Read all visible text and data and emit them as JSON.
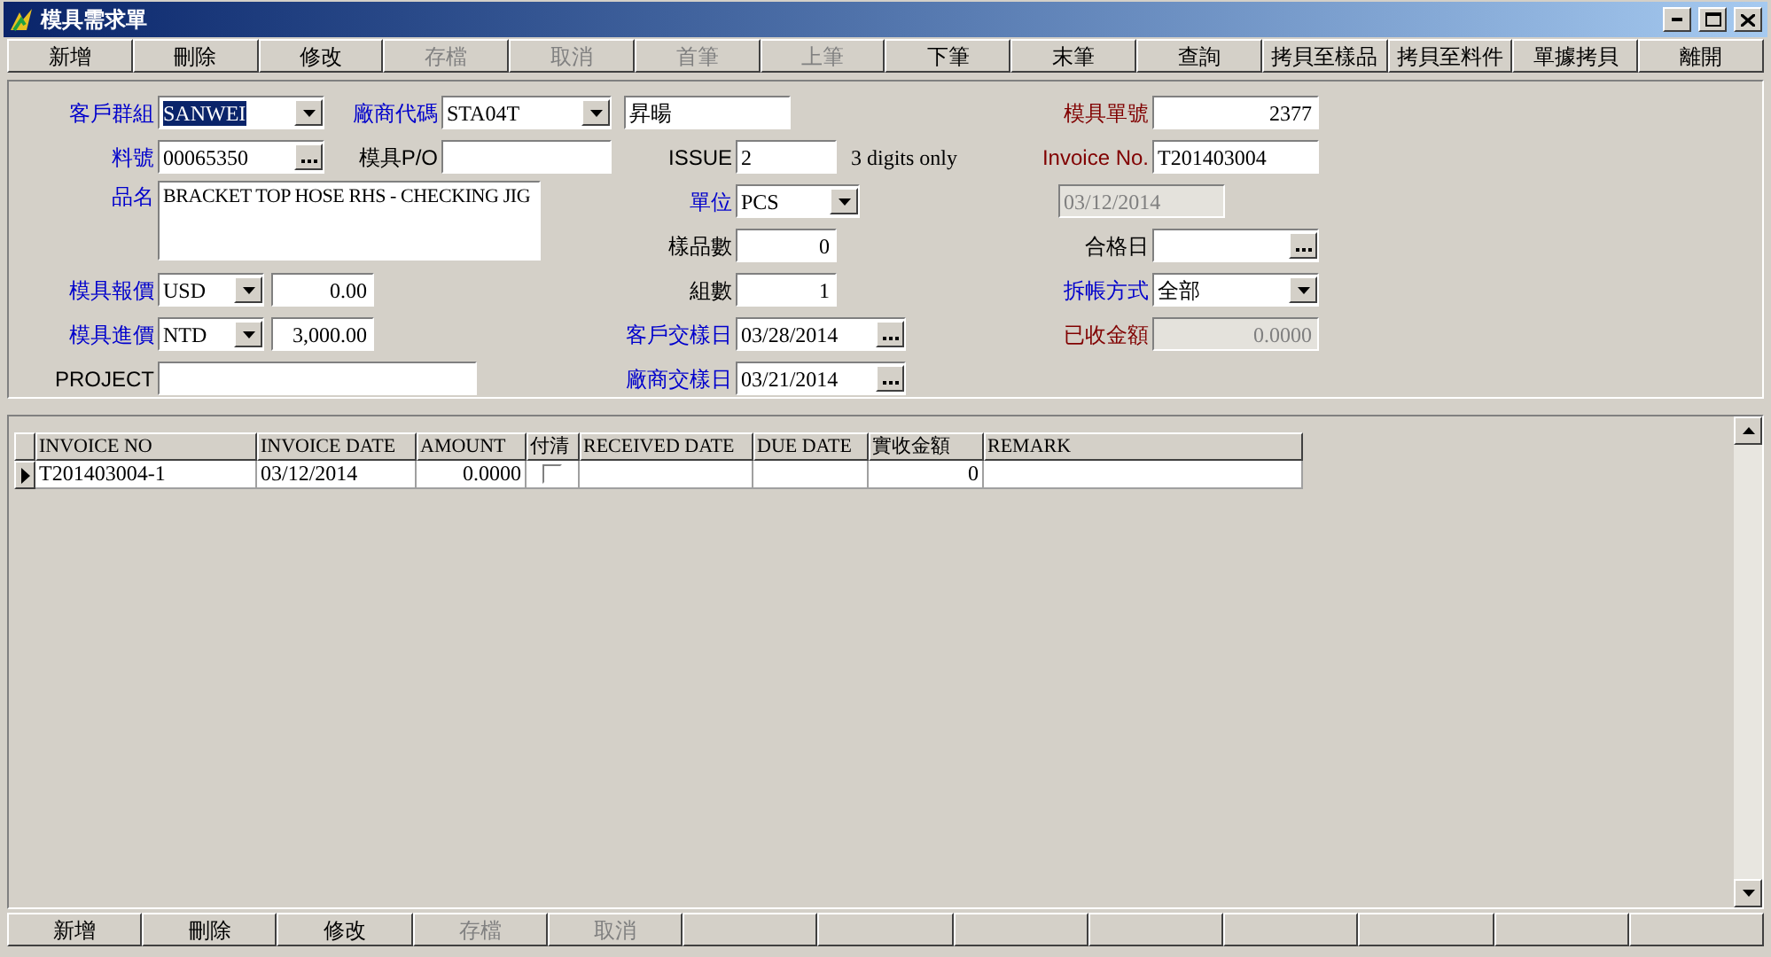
{
  "window": {
    "title": "模具需求單"
  },
  "toolbar": [
    {
      "label": "新增",
      "disabled": false
    },
    {
      "label": "刪除",
      "disabled": false
    },
    {
      "label": "修改",
      "disabled": false
    },
    {
      "label": "存檔",
      "disabled": true
    },
    {
      "label": "取消",
      "disabled": true
    },
    {
      "label": "首筆",
      "disabled": true
    },
    {
      "label": "上筆",
      "disabled": true
    },
    {
      "label": "下筆",
      "disabled": false
    },
    {
      "label": "末筆",
      "disabled": false
    },
    {
      "label": "查詢",
      "disabled": false
    },
    {
      "label": "拷貝至樣品",
      "disabled": false
    },
    {
      "label": "拷貝至料件",
      "disabled": false
    },
    {
      "label": "單據拷貝",
      "disabled": false
    },
    {
      "label": "離開",
      "disabled": false
    }
  ],
  "form": {
    "customer_group": {
      "label": "客戶群組",
      "color": "#0000cc",
      "value": "SANWEI",
      "highlighted": true
    },
    "vendor_code": {
      "label": "廠商代碼",
      "color": "#0000cc",
      "value": "STA04T"
    },
    "vendor_name": {
      "value": "昇暘"
    },
    "part_no": {
      "label": "料號",
      "color": "#0000cc",
      "value": "00065350"
    },
    "mold_po": {
      "label": "模具P/O",
      "color": "#000000"
    },
    "product_name": {
      "label": "品名",
      "color": "#0000cc",
      "value": "BRACKET TOP HOSE RHS - CHECKING JIG"
    },
    "mold_quote": {
      "label": "模具報價",
      "color": "#0000cc",
      "currency": "USD",
      "amount": "0.00"
    },
    "mold_cost": {
      "label": "模具進價",
      "color": "#0000cc",
      "currency": "NTD",
      "amount": "3,000.00"
    },
    "project": {
      "label": "PROJECT",
      "color": "#000000"
    },
    "issue": {
      "label": "ISSUE",
      "color": "#000000",
      "value": "2",
      "hint": "3 digits only"
    },
    "unit": {
      "label": "單位",
      "color": "#0000cc",
      "value": "PCS"
    },
    "sample_qty": {
      "label": "樣品數",
      "color": "#000000",
      "value": "0"
    },
    "set_qty": {
      "label": "組數",
      "color": "#000000",
      "value": "1"
    },
    "customer_sample_date": {
      "label": "客戶交樣日",
      "color": "#0000cc",
      "value": "03/28/2014"
    },
    "vendor_sample_date": {
      "label": "廠商交樣日",
      "color": "#0000cc",
      "value": "03/21/2014"
    },
    "mold_no": {
      "label": "模具單號",
      "color": "#800000",
      "value": "2377"
    },
    "invoice_no": {
      "label": "Invoice No.",
      "color": "#800000",
      "value": "T201403004"
    },
    "invoice_date": {
      "value": "03/12/2014",
      "disabled": true
    },
    "pass_date": {
      "label": "合格日",
      "color": "#000000"
    },
    "split_method": {
      "label": "拆帳方式",
      "color": "#0000cc",
      "value": "全部"
    },
    "received_total": {
      "label": "已收金額",
      "color": "#800000",
      "value": "0.0000",
      "disabled": true
    }
  },
  "grid": {
    "columns": [
      "INVOICE NO",
      "INVOICE DATE",
      "AMOUNT",
      "付清",
      "RECEIVED DATE",
      "DUE DATE",
      "實收金額",
      "REMARK"
    ],
    "rows": [
      {
        "current": true,
        "invoice_no": "T201403004-1",
        "invoice_date": "03/12/2014",
        "amount": "0.0000",
        "paid": false,
        "received_amount": "0"
      }
    ]
  },
  "bottom_toolbar": [
    {
      "label": "新增",
      "disabled": false
    },
    {
      "label": "刪除",
      "disabled": false
    },
    {
      "label": "修改",
      "disabled": false
    },
    {
      "label": "存檔",
      "disabled": true
    },
    {
      "label": "取消",
      "disabled": true
    }
  ]
}
